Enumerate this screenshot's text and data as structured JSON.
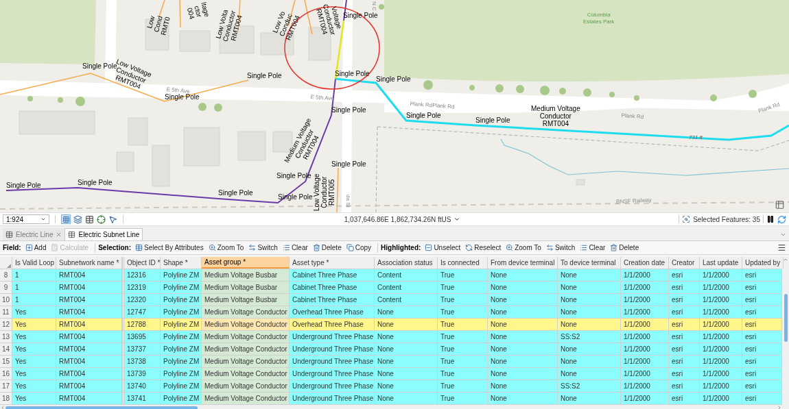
{
  "map": {
    "labels": [
      {
        "kind": "conductor",
        "lines": [
          "Low",
          "Cond",
          "RMT0"
        ]
      },
      {
        "kind": "conductor",
        "lines": [
          "ltage",
          "ctor",
          "004"
        ]
      },
      {
        "kind": "conductor",
        "lines": [
          "Low Volta",
          "Conductor",
          "RMT004"
        ]
      },
      {
        "kind": "conductor",
        "lines": [
          "Low Vo",
          "Conduc",
          "RMT004"
        ]
      },
      {
        "kind": "conductor",
        "lines": [
          "Voltage",
          "Conductor",
          "RMT004"
        ]
      },
      {
        "kind": "pole",
        "lines": [
          "Single Pole"
        ]
      },
      {
        "kind": "street",
        "lines": [
          "N C"
        ]
      },
      {
        "kind": "park",
        "lines": [
          "Columbia",
          "Estates Park"
        ]
      },
      {
        "kind": "pole",
        "lines": [
          "Single Pole"
        ]
      },
      {
        "kind": "conductor",
        "lines": [
          "Low Voltage",
          "Conductor",
          "RMT004"
        ]
      },
      {
        "kind": "pole",
        "lines": [
          "Single Pole"
        ]
      },
      {
        "kind": "pole",
        "lines": [
          "Single Pole"
        ]
      },
      {
        "kind": "pole",
        "lines": [
          "Single Pole"
        ]
      },
      {
        "kind": "pole",
        "lines": [
          "Single Pole"
        ]
      },
      {
        "kind": "street",
        "lines": [
          "E 5th Ave"
        ]
      },
      {
        "kind": "street",
        "lines": [
          "E 5th Ave"
        ]
      },
      {
        "kind": "pole",
        "lines": [
          "Single Pole"
        ]
      },
      {
        "kind": "pole",
        "lines": [
          "Single Pole"
        ]
      },
      {
        "kind": "street",
        "lines": [
          "Plank RdPlank Rd"
        ]
      },
      {
        "kind": "pole",
        "lines": [
          "Single Pole"
        ]
      },
      {
        "kind": "conductor",
        "lines": [
          "Medium Voltage",
          "Conductor",
          "RMT004"
        ]
      },
      {
        "kind": "street",
        "lines": [
          "Plank Rd"
        ]
      },
      {
        "kind": "street",
        "lines": [
          "Plank Rd"
        ]
      },
      {
        "kind": "measure",
        "lines": [
          "731 ft"
        ]
      },
      {
        "kind": "conductor",
        "lines": [
          "Medium Voltage",
          "Conductor",
          "RMT004"
        ]
      },
      {
        "kind": "pole",
        "lines": [
          "Single Pole"
        ]
      },
      {
        "kind": "pole",
        "lines": [
          "Single Pole"
        ]
      },
      {
        "kind": "pole",
        "lines": [
          "Single Pole"
        ]
      },
      {
        "kind": "pole",
        "lines": [
          "Single Pole"
        ]
      },
      {
        "kind": "pole",
        "lines": [
          "Single Pole"
        ]
      },
      {
        "kind": "conductor",
        "lines": [
          "Low Voltage",
          "Conductor",
          "RMT005"
        ]
      },
      {
        "kind": "pole",
        "lines": [
          "Single Pole"
        ]
      },
      {
        "kind": "street",
        "lines": [
          "da St"
        ]
      },
      {
        "kind": "street",
        "lines": [
          "BNSF Railway"
        ]
      }
    ]
  },
  "status_bar": {
    "scale": "1:924",
    "coordinates": "1,037,646.86E 1,862,734.26N ftUS",
    "selected_features": "Selected Features: 35"
  },
  "tabs": [
    {
      "label": "Electric Line",
      "selected": false,
      "closable": true
    },
    {
      "label": "Electric Subnet Line",
      "selected": true,
      "closable": false
    }
  ],
  "toolbar": {
    "groups": [
      {
        "label": "Field:",
        "buttons": [
          {
            "label": "Add",
            "disabled": false
          },
          {
            "label": "Calculate",
            "disabled": true
          }
        ]
      },
      {
        "label": "Selection:",
        "buttons": [
          {
            "label": "Select By Attributes",
            "disabled": false
          },
          {
            "label": "Zoom To",
            "disabled": false
          },
          {
            "label": "Switch",
            "disabled": false
          },
          {
            "label": "Clear",
            "disabled": false
          },
          {
            "label": "Delete",
            "disabled": false
          },
          {
            "label": "Copy",
            "disabled": false
          }
        ]
      },
      {
        "label": "Highlighted:",
        "buttons": [
          {
            "label": "Unselect",
            "disabled": false
          },
          {
            "label": "Reselect",
            "disabled": false
          },
          {
            "label": "Zoom To",
            "disabled": false
          },
          {
            "label": "Switch",
            "disabled": false
          },
          {
            "label": "Clear",
            "disabled": false
          },
          {
            "label": "Delete",
            "disabled": false
          }
        ]
      }
    ]
  },
  "table": {
    "columns": [
      {
        "label": "Is Valid Loop",
        "selected": false,
        "sorted": false
      },
      {
        "label": "Subnetwork name *",
        "selected": false,
        "sorted": true
      },
      {
        "label": "Object ID *",
        "selected": false,
        "sorted": false
      },
      {
        "label": "Shape *",
        "selected": false,
        "sorted": false
      },
      {
        "label": "Asset group *",
        "selected": true,
        "sorted": false
      },
      {
        "label": "Asset type *",
        "selected": false,
        "sorted": false
      },
      {
        "label": "Association status",
        "selected": false,
        "sorted": false
      },
      {
        "label": "Is connected",
        "selected": false,
        "sorted": false
      },
      {
        "label": "From device terminal",
        "selected": false,
        "sorted": false
      },
      {
        "label": "To device terminal",
        "selected": false,
        "sorted": false
      },
      {
        "label": "Creation date",
        "selected": false,
        "sorted": false
      },
      {
        "label": "Creator",
        "selected": false,
        "sorted": false
      },
      {
        "label": "Last update",
        "selected": false,
        "sorted": false
      },
      {
        "label": "Updated by",
        "selected": false,
        "sorted": false
      }
    ],
    "rows": [
      {
        "number": "8",
        "highlighted": false,
        "cells": [
          "1",
          "RMT004",
          "12316",
          "Polyline ZM",
          "Medium Voltage Busbar",
          "Cabinet Three Phase",
          "Content",
          "True",
          "None",
          "None",
          "1/1/2000",
          "esri",
          "1/1/2000",
          "esri"
        ]
      },
      {
        "number": "9",
        "highlighted": false,
        "cells": [
          "1",
          "RMT004",
          "12319",
          "Polyline ZM",
          "Medium Voltage Busbar",
          "Cabinet Three Phase",
          "Content",
          "True",
          "None",
          "None",
          "1/1/2000",
          "esri",
          "1/1/2000",
          "esri"
        ]
      },
      {
        "number": "10",
        "highlighted": false,
        "cells": [
          "1",
          "RMT004",
          "12320",
          "Polyline ZM",
          "Medium Voltage Busbar",
          "Cabinet Three Phase",
          "Content",
          "True",
          "None",
          "None",
          "1/1/2000",
          "esri",
          "1/1/2000",
          "esri"
        ]
      },
      {
        "number": "11",
        "highlighted": false,
        "cells": [
          "Yes",
          "RMT004",
          "12747",
          "Polyline ZM",
          "Medium Voltage Conductor",
          "Overhead Three Phase",
          "None",
          "True",
          "None",
          "None",
          "1/1/2000",
          "esri",
          "1/1/2000",
          "esri"
        ]
      },
      {
        "number": "12",
        "highlighted": true,
        "cells": [
          "Yes",
          "RMT004",
          "12788",
          "Polyline ZM",
          "Medium Voltage Conductor",
          "Overhead Three Phase",
          "None",
          "True",
          "None",
          "None",
          "1/1/2000",
          "esri",
          "1/1/2000",
          "esri"
        ]
      },
      {
        "number": "13",
        "highlighted": false,
        "cells": [
          "Yes",
          "RMT004",
          "13695",
          "Polyline ZM",
          "Medium Voltage Conductor",
          "Underground Three Phase",
          "None",
          "True",
          "None",
          "SS:S2",
          "1/1/2000",
          "esri",
          "1/1/2000",
          "esri"
        ]
      },
      {
        "number": "14",
        "highlighted": false,
        "cells": [
          "Yes",
          "RMT004",
          "13737",
          "Polyline ZM",
          "Medium Voltage Conductor",
          "Underground Three Phase",
          "None",
          "True",
          "None",
          "None",
          "1/1/2000",
          "esri",
          "1/1/2000",
          "esri"
        ]
      },
      {
        "number": "15",
        "highlighted": false,
        "cells": [
          "Yes",
          "RMT004",
          "13738",
          "Polyline ZM",
          "Medium Voltage Conductor",
          "Underground Three Phase",
          "None",
          "True",
          "None",
          "None",
          "1/1/2000",
          "esri",
          "1/1/2000",
          "esri"
        ]
      },
      {
        "number": "16",
        "highlighted": false,
        "cells": [
          "Yes",
          "RMT004",
          "13739",
          "Polyline ZM",
          "Medium Voltage Conductor",
          "Underground Three Phase",
          "None",
          "True",
          "None",
          "None",
          "1/1/2000",
          "esri",
          "1/1/2000",
          "esri"
        ]
      },
      {
        "number": "17",
        "highlighted": false,
        "cells": [
          "Yes",
          "RMT004",
          "13740",
          "Polyline ZM",
          "Medium Voltage Conductor",
          "Underground Three Phase",
          "None",
          "True",
          "None",
          "SS:S2",
          "1/1/2000",
          "esri",
          "1/1/2000",
          "esri"
        ]
      },
      {
        "number": "18",
        "highlighted": false,
        "cells": [
          "Yes",
          "RMT004",
          "13741",
          "Polyline ZM",
          "Medium Voltage Conductor",
          "Underground Three Phase",
          "None",
          "True",
          "None",
          "None",
          "1/1/2000",
          "esri",
          "1/1/2000",
          "esri"
        ]
      }
    ]
  }
}
